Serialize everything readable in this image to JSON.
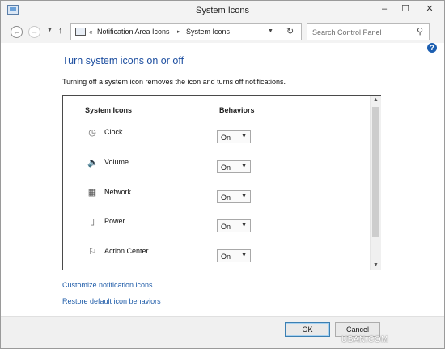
{
  "window": {
    "title": "System Icons",
    "controls": {
      "minimize": "–",
      "maximize": "☐",
      "close": "✕"
    }
  },
  "nav": {
    "back_icon": "←",
    "forward_icon": "→",
    "recent_icon": "▼",
    "up_icon": "↑",
    "address": {
      "chevron": "«",
      "crumbs": [
        "Notification Area Icons",
        "System Icons"
      ],
      "separator": "▸",
      "dropdown_icon": "▼",
      "refresh_icon": "↻"
    },
    "search": {
      "placeholder": "Search Control Panel",
      "icon": "⚲"
    }
  },
  "help_icon": "?",
  "content": {
    "heading": "Turn system icons on or off",
    "description": "Turning off a system icon removes the icon and turns off notifications.",
    "table": {
      "headers": {
        "icons": "System Icons",
        "behaviors": "Behaviors"
      },
      "rows": [
        {
          "label": "Clock",
          "icon": "clock-icon",
          "glyph": "◷",
          "behavior": "On"
        },
        {
          "label": "Volume",
          "icon": "volume-icon",
          "glyph": "🔈",
          "behavior": "On"
        },
        {
          "label": "Network",
          "icon": "network-icon",
          "glyph": "▦",
          "behavior": "On"
        },
        {
          "label": "Power",
          "icon": "power-icon",
          "glyph": "▯",
          "behavior": "On"
        },
        {
          "label": "Action Center",
          "icon": "flag-icon",
          "glyph": "⚐",
          "behavior": "On"
        }
      ],
      "select_arrow": "▼",
      "scroll_up": "▲",
      "scroll_down": "▼"
    },
    "links": {
      "customize": "Customize notification icons",
      "restore": "Restore default icon behaviors"
    }
  },
  "footer": {
    "ok": "OK",
    "cancel": "Cancel"
  },
  "watermark": "UBAN.COM"
}
